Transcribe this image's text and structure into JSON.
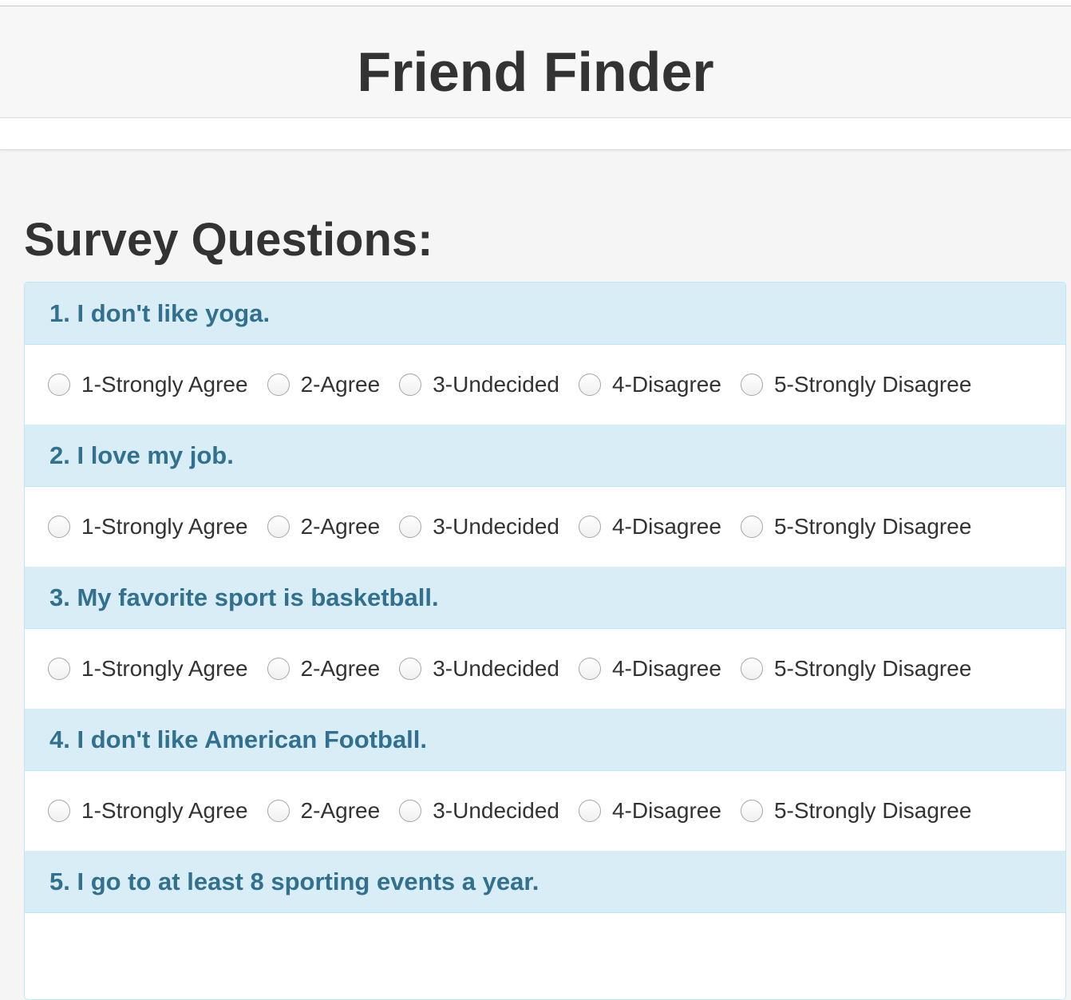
{
  "header": {
    "title": "Friend Finder"
  },
  "survey": {
    "title": "Survey Questions:",
    "questions": [
      {
        "label": "1. I don't like yoga.",
        "options": [
          "1-Strongly Agree",
          "2-Agree",
          "3-Undecided",
          "4-Disagree",
          "5-Strongly Disagree"
        ]
      },
      {
        "label": "2. I love my job.",
        "options": [
          "1-Strongly Agree",
          "2-Agree",
          "3-Undecided",
          "4-Disagree",
          "5-Strongly Disagree"
        ]
      },
      {
        "label": "3. My favorite sport is basketball.",
        "options": [
          "1-Strongly Agree",
          "2-Agree",
          "3-Undecided",
          "4-Disagree",
          "5-Strongly Disagree"
        ]
      },
      {
        "label": "4. I don't like American Football.",
        "options": [
          "1-Strongly Agree",
          "2-Agree",
          "3-Undecided",
          "4-Disagree",
          "5-Strongly Disagree"
        ]
      },
      {
        "label": "5. I go to at least 8 sporting events a year.",
        "options": []
      }
    ]
  },
  "colors": {
    "panel_heading_bg": "#d9edf7",
    "panel_heading_text": "#31708f",
    "panel_border": "#bce8f1",
    "page_bg": "#f5f5f5"
  }
}
